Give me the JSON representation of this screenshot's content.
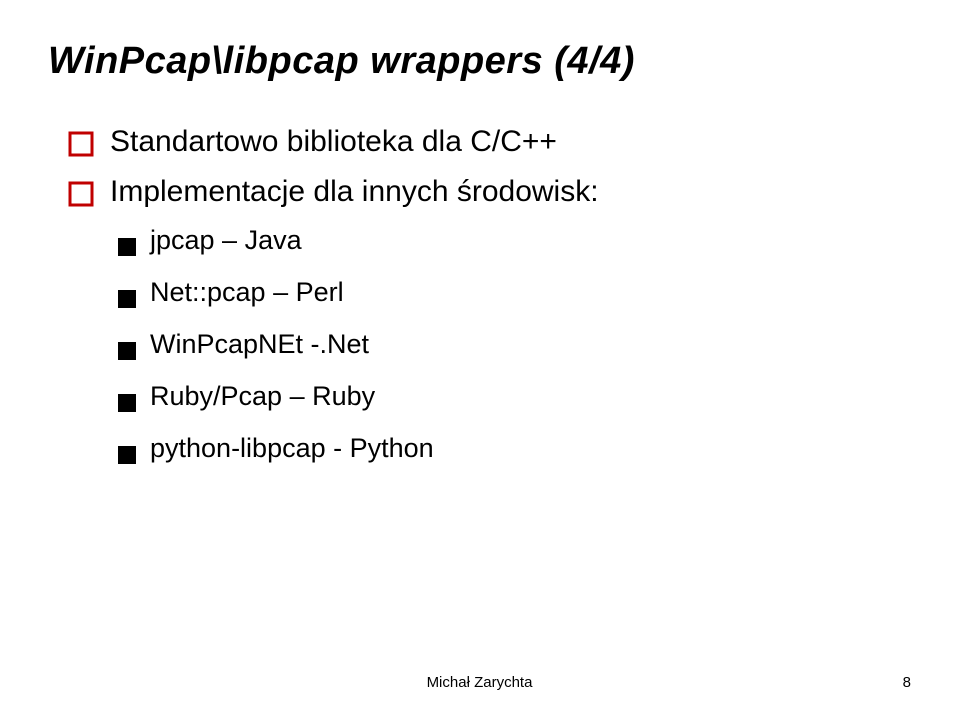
{
  "title": "WinPcap\\libpcap wrappers (4/4)",
  "bullets": [
    {
      "text": "Standartowo biblioteka dla C/C++"
    },
    {
      "text": "Implementacje dla innych środowisk:"
    }
  ],
  "subbullets": [
    {
      "text": "jpcap – Java"
    },
    {
      "text": "Net::pcap – Perl"
    },
    {
      "text": "WinPcapNEt -.Net"
    },
    {
      "text": "Ruby/Pcap – Ruby"
    },
    {
      "text": "python-libpcap - Python"
    }
  ],
  "footer": {
    "author": "Michał Zarychta",
    "page": "8"
  }
}
